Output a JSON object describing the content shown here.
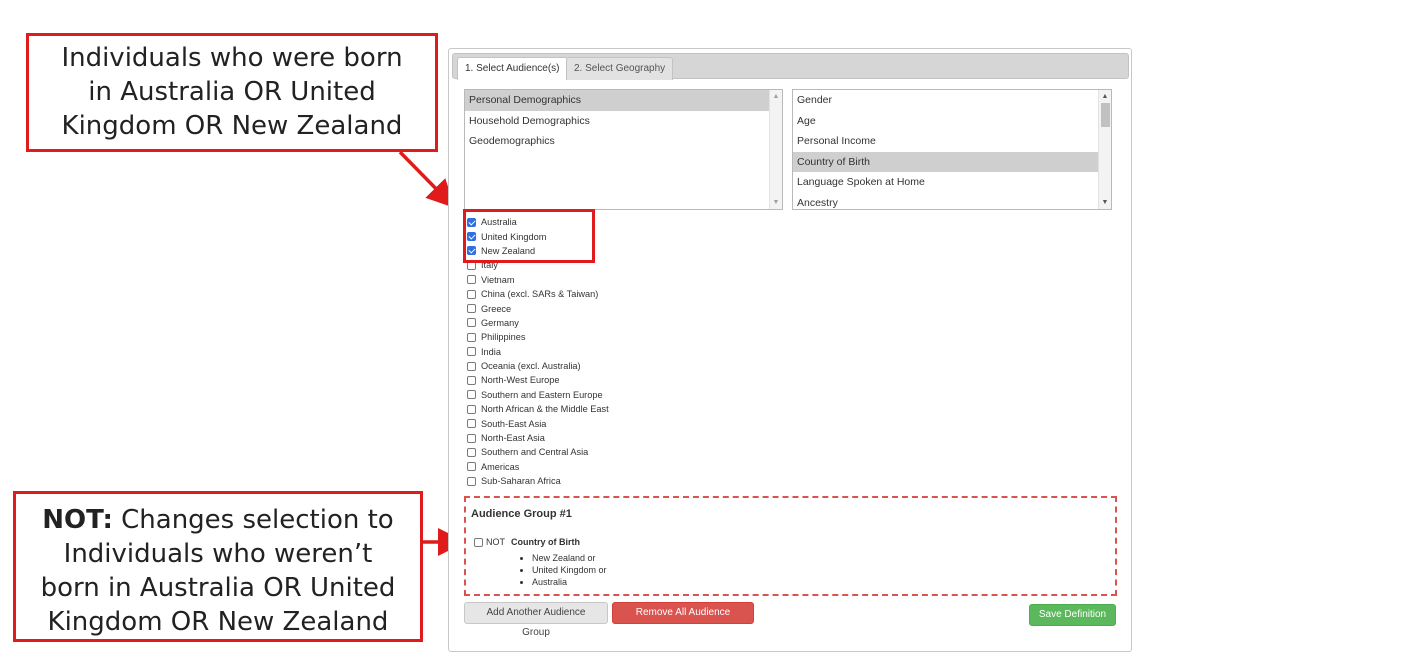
{
  "callouts": {
    "top": [
      "Individuals who were born",
      "in Australia OR United",
      "Kingdom OR New Zealand"
    ],
    "bottom": {
      "bold": "NOT:",
      "line1_rest": " Changes selection to",
      "lines": [
        "Individuals who weren’t",
        "born in Australia OR United",
        "Kingdom OR New Zealand"
      ]
    }
  },
  "tabs": [
    "1. Select Audience(s)",
    "2. Select Geography"
  ],
  "categories": [
    "Personal Demographics",
    "Household Demographics",
    "Geodemographics"
  ],
  "variables": [
    "Gender",
    "Age",
    "Personal Income",
    "Country of Birth",
    "Language Spoken at Home",
    "Ancestry"
  ],
  "countries": [
    {
      "label": "Australia",
      "checked": true
    },
    {
      "label": "United Kingdom",
      "checked": true
    },
    {
      "label": "New Zealand",
      "checked": true
    },
    {
      "label": "Italy",
      "checked": false
    },
    {
      "label": "Vietnam",
      "checked": false
    },
    {
      "label": "China (excl. SARs & Taiwan)",
      "checked": false
    },
    {
      "label": "Greece",
      "checked": false
    },
    {
      "label": "Germany",
      "checked": false
    },
    {
      "label": "Philippines",
      "checked": false
    },
    {
      "label": "India",
      "checked": false
    },
    {
      "label": "Oceania (excl. Australia)",
      "checked": false
    },
    {
      "label": "North-West Europe",
      "checked": false
    },
    {
      "label": "Southern and Eastern Europe",
      "checked": false
    },
    {
      "label": "North African & the Middle East",
      "checked": false
    },
    {
      "label": "South-East Asia",
      "checked": false
    },
    {
      "label": "North-East Asia",
      "checked": false
    },
    {
      "label": "Southern and Central Asia",
      "checked": false
    },
    {
      "label": "Americas",
      "checked": false
    },
    {
      "label": "Sub-Saharan Africa",
      "checked": false
    }
  ],
  "audience_group": {
    "title": "Audience Group #1",
    "not_label": "NOT",
    "criteria_label": "Country of Birth",
    "items": [
      "New Zealand or",
      "United Kingdom or",
      "Australia"
    ]
  },
  "buttons": {
    "add": "Add Another Audience Group",
    "remove": "Remove All Audience Groups",
    "save": "Save Definition"
  },
  "colors": {
    "callout_red": "#e01b1b",
    "remove_button": "#d9534f",
    "save_button": "#5cb85c",
    "checkbox_checked": "#2f6fe0"
  }
}
